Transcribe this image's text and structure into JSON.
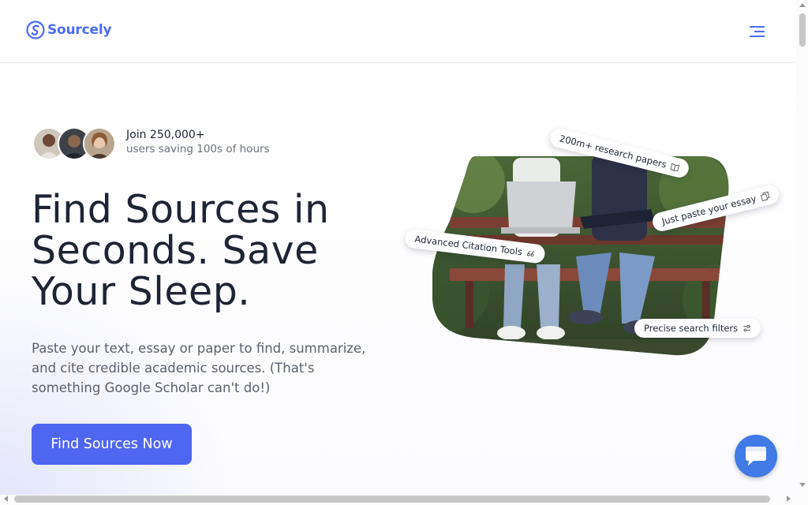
{
  "brand": {
    "name": "Sourcely",
    "color": "#4b6cf5"
  },
  "header": {
    "menu_icon": "hamburger-menu-icon"
  },
  "social_proof": {
    "title": "Join 250,000+",
    "subtitle": "users saving 100s of hours",
    "avatars": [
      "avatar-user-1",
      "avatar-user-2",
      "avatar-user-3"
    ]
  },
  "hero": {
    "headline": "Find Sources in Seconds. Save Your Sleep.",
    "subtext": "Paste your text, essay or paper to find, summarize, and cite credible academic sources. (That's something Google Scholar can't do!)",
    "cta_label": "Find Sources Now",
    "cta_color": "#4f66f0"
  },
  "feature_chips": [
    {
      "label": "200m+ research papers",
      "icon": "book-icon"
    },
    {
      "label": "Just paste your essay",
      "icon": "copy-icon"
    },
    {
      "label": "Advanced Citation Tools",
      "icon": "quote-icon"
    },
    {
      "label": "Precise search filters",
      "icon": "filter-sliders-icon"
    }
  ],
  "chat": {
    "icon": "chat-bubble-icon",
    "color": "#3f7ae6"
  }
}
